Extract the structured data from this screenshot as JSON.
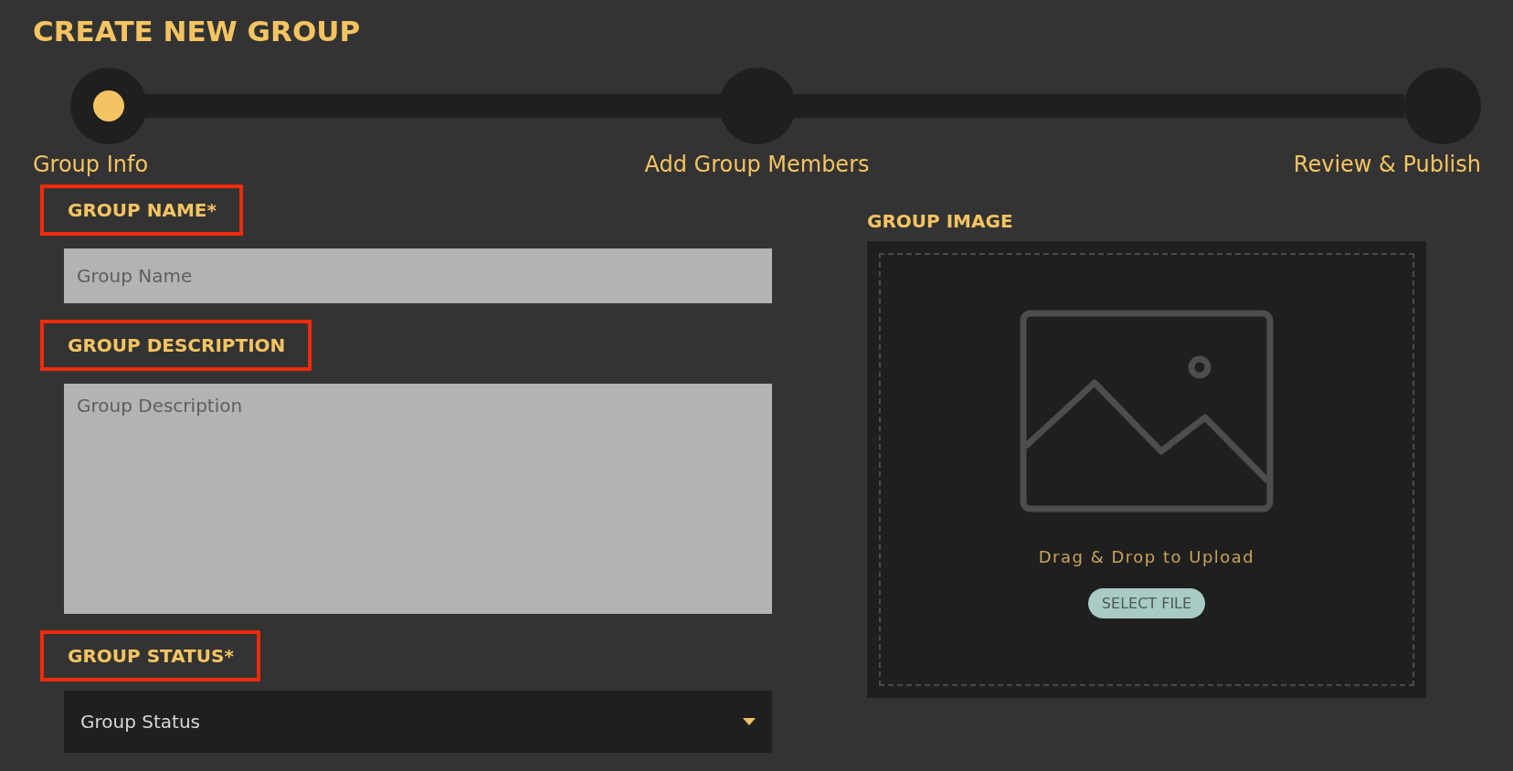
{
  "page_title": "CREATE NEW GROUP",
  "steps": [
    {
      "label": "Group Info",
      "selected": true
    },
    {
      "label": "Add Group Members",
      "selected": false
    },
    {
      "label": "Review & Publish",
      "selected": false
    }
  ],
  "fields": [
    {
      "kind": "text",
      "label": "GROUP NAME*",
      "placeholder": "Group Name",
      "highlighted": true
    },
    {
      "kind": "textarea",
      "label": "GROUP DESCRIPTION",
      "placeholder": "Group Description",
      "highlighted": true
    },
    {
      "kind": "select",
      "label": "GROUP STATUS*",
      "value": "Group Status",
      "highlighted": true
    }
  ],
  "image_upload": {
    "label": "GROUP IMAGE",
    "hint": "Drag & Drop to Upload",
    "button": "SELECT FILE"
  }
}
